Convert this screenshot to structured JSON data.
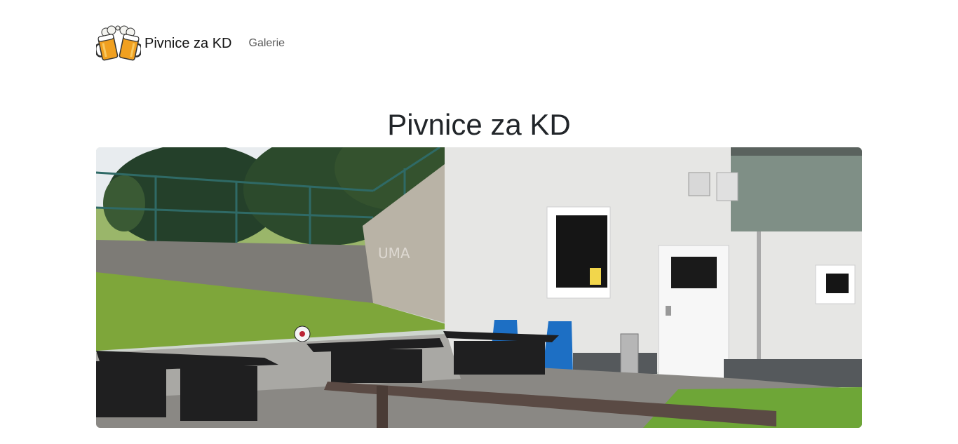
{
  "navbar": {
    "brand_text": "Pivnice za KD",
    "links": [
      {
        "label": "Galerie"
      }
    ]
  },
  "main": {
    "title": "Pivnice za KD"
  },
  "hero": {
    "icon": "beer-mugs-logo",
    "alt": "outdoor terrace photo"
  }
}
